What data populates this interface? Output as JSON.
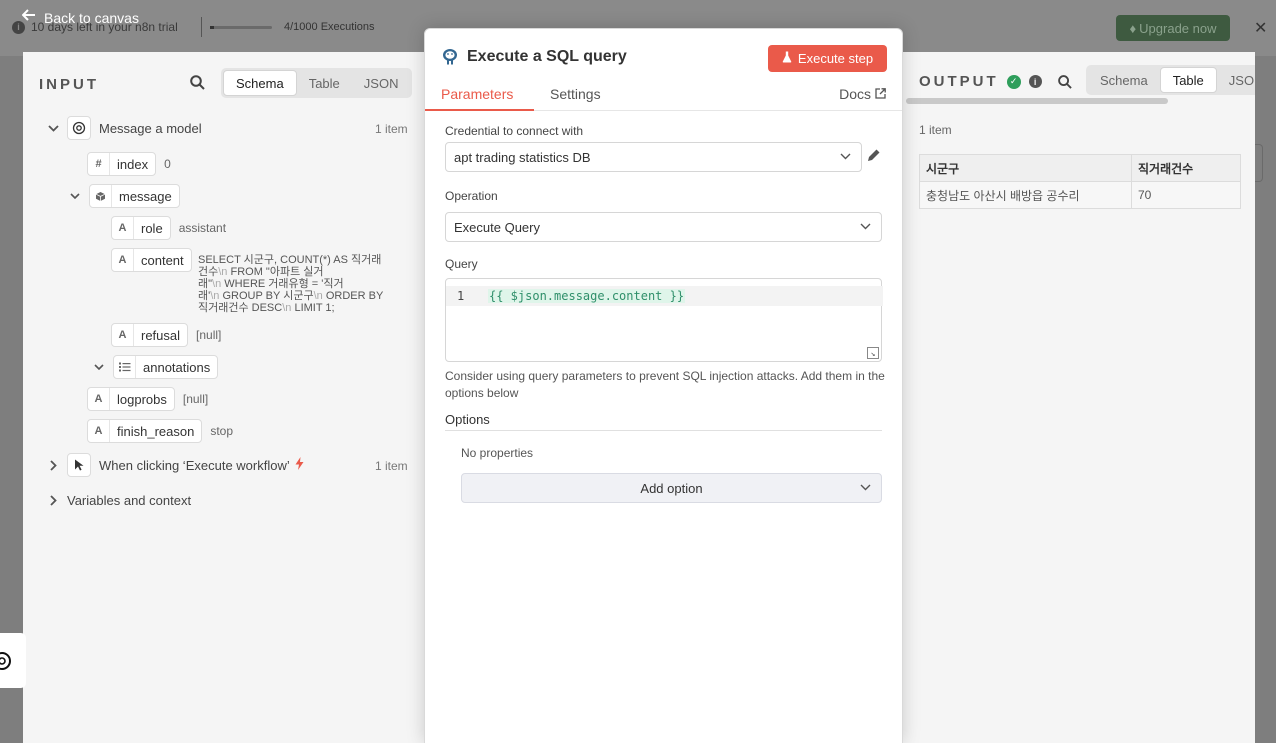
{
  "background": {
    "trial_text": "10 days left in your n8n trial",
    "executions_text": "4/1000 Executions",
    "upgrade_label": "Upgrade now",
    "close_glyph": "✕",
    "back_label": "Back to canvas"
  },
  "input": {
    "title": "INPUT",
    "tabs": [
      "Schema",
      "Table",
      "JSON"
    ],
    "active_tab": "Schema",
    "node1": {
      "label": "Message a model",
      "count": "1 item"
    },
    "fields": {
      "index": {
        "type": "#",
        "name": "index",
        "value": "0"
      },
      "message": {
        "type": "cube",
        "name": "message"
      },
      "role": {
        "type": "A",
        "name": "role",
        "value": "assistant"
      },
      "content": {
        "type": "A",
        "name": "content",
        "line1": "SELECT 시군구, COUNT(*) AS 직거래",
        "line2": "건수",
        "nl": "\\n",
        "line2b": " FROM \"아파트 실거",
        "line3": "래\"",
        "line3b": " WHERE 거래유형 = '직거",
        "line4": "래'",
        "line4b": " GROUP BY 시군구",
        "line4c": " ORDER BY",
        "line5": "직거래건수 DESC",
        "line5b": " LIMIT 1;"
      },
      "refusal": {
        "type": "A",
        "name": "refusal",
        "value": "[null]"
      },
      "annotations": {
        "type": "list",
        "name": "annotations"
      },
      "logprobs": {
        "type": "A",
        "name": "logprobs",
        "value": "[null]"
      },
      "finish_reason": {
        "type": "A",
        "name": "finish_reason",
        "value": "stop"
      }
    },
    "node2": {
      "label": "When clicking ‘Execute workflow’",
      "count": "1 item"
    },
    "node3": {
      "label": "Variables and context"
    }
  },
  "params": {
    "title": "Execute a SQL query",
    "execute_label": "Execute step",
    "tabs": {
      "parameters": "Parameters",
      "settings": "Settings",
      "docs": "Docs"
    },
    "credential_label": "Credential to connect with",
    "credential_value": "apt trading statistics DB",
    "operation_label": "Operation",
    "operation_value": "Execute Query",
    "query_label": "Query",
    "query_line_number": "1",
    "query_value": "{{ $json.message.content }}",
    "hint": "Consider using query parameters to prevent SQL injection attacks. Add them in the options below",
    "options_label": "Options",
    "no_properties": "No properties",
    "add_option_label": "Add option"
  },
  "output": {
    "title": "OUTPUT",
    "tabs": [
      "Schema",
      "Table",
      "JSON"
    ],
    "active_tab": "Table",
    "item_count": "1 item",
    "table": {
      "headers": [
        "시군구",
        "직거래건수"
      ],
      "rows": [
        [
          "충청남도 아산시 배방읍 공수리",
          "70"
        ]
      ]
    }
  },
  "colors": {
    "accent": "#ea5a4a",
    "success": "#2e9e5b",
    "upgrade": "#3e5a40"
  }
}
